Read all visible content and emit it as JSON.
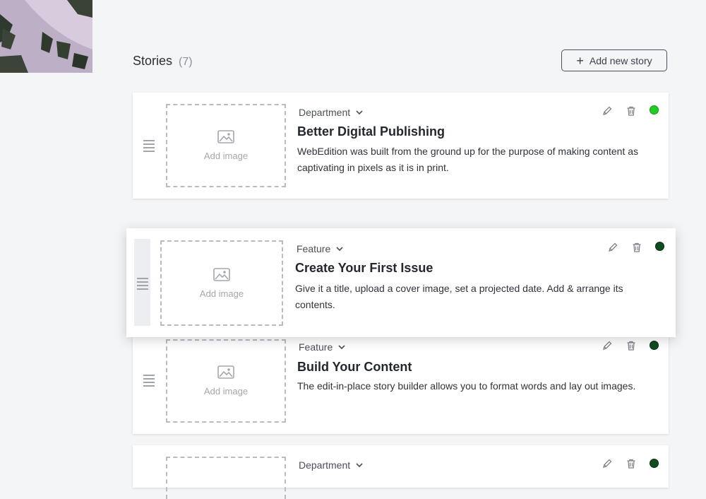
{
  "header": {
    "title": "Stories",
    "count": "(7)",
    "add_button": "Add new story"
  },
  "image_slot_label": "Add image",
  "status_colors": {
    "published": "#22cc22",
    "draft": "#0f4d1f"
  },
  "stories": [
    {
      "category": "Department",
      "title": "Better Digital Publishing",
      "body": "WebEdition was built from the ground up for the purpose of making content as captivating in pixels as it is in print.",
      "status": "published"
    },
    {
      "category": "Feature",
      "title": "Create Your First Issue",
      "body": "Give it a title, upload a cover image, set a projected date. Add & arrange its contents.",
      "status": "draft"
    },
    {
      "category": "Feature",
      "title": "Build Your Content",
      "body": "The edit-in-place story builder allows you to format words and lay out images.",
      "status": "draft"
    },
    {
      "category": "Department",
      "title": "",
      "body": "",
      "status": "draft"
    }
  ]
}
